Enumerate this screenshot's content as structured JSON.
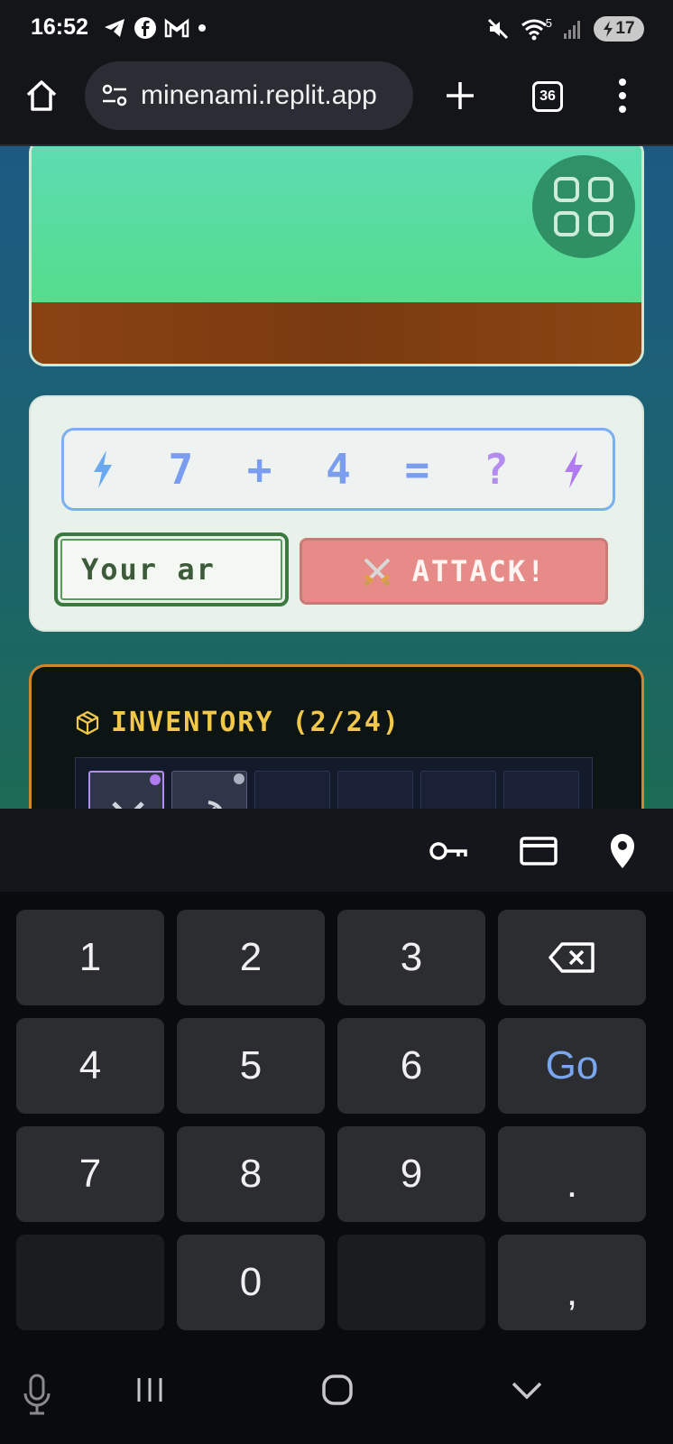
{
  "status_bar": {
    "time": "16:52",
    "battery": "17",
    "network": "5"
  },
  "browser": {
    "url": "minenami.replit.app",
    "tab_count": "36"
  },
  "quiz": {
    "operand_a": "7",
    "operator": "+",
    "operand_b": "4",
    "equals": "=",
    "unknown": "?",
    "answer_placeholder": "Your ar",
    "attack_label": "ATTACK!"
  },
  "inventory": {
    "title": "INVENTORY (2/24)",
    "used": 2,
    "capacity": 24,
    "slots": [
      {
        "item": "sword",
        "rarity_color": "#b07af0",
        "selected": true
      },
      {
        "item": "pickaxe",
        "rarity_color": "#aab0c0",
        "selected": false
      },
      {
        "item": "",
        "rarity_color": "",
        "selected": false
      },
      {
        "item": "",
        "rarity_color": "",
        "selected": false
      },
      {
        "item": "",
        "rarity_color": "",
        "selected": false
      },
      {
        "item": "",
        "rarity_color": "",
        "selected": false
      }
    ]
  },
  "keyboard": {
    "keys": [
      "1",
      "2",
      "3",
      "4",
      "5",
      "6",
      "7",
      "8",
      "9",
      "0",
      ".",
      ","
    ],
    "go_label": "Go"
  },
  "colors": {
    "accent_blue": "#7ab0f0",
    "attack_red": "#e68b88",
    "inventory_gold": "#f2c84a",
    "inventory_border": "#d4852a",
    "input_green": "#3b7a3f"
  }
}
